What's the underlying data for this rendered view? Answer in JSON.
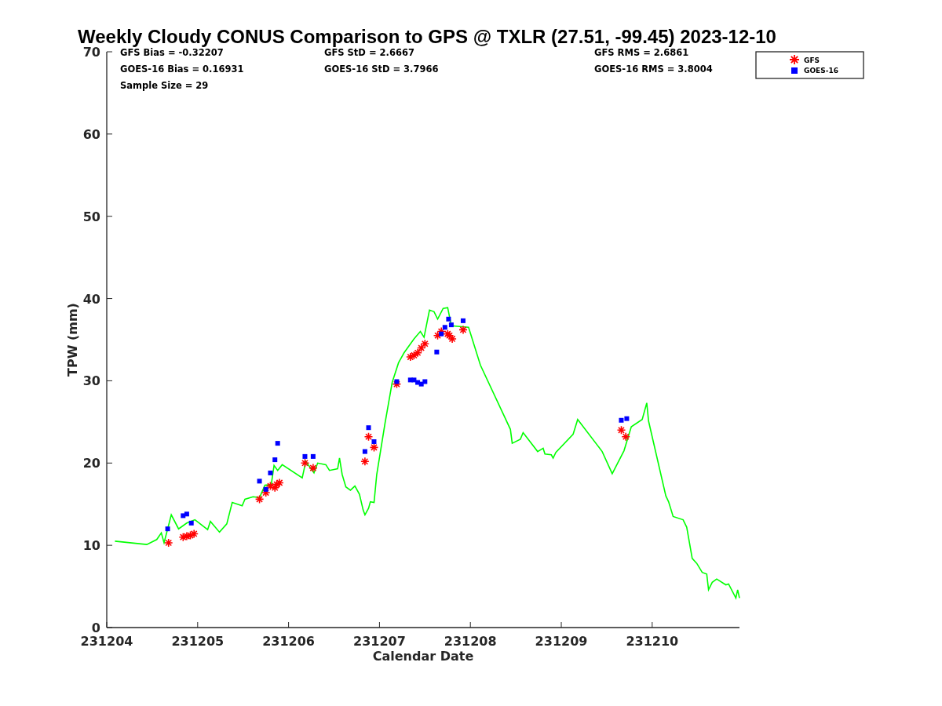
{
  "chart_data": {
    "type": "scatter",
    "title": "Weekly Cloudy CONUS Comparison to GPS @ TXLR (27.51, -99.45) 2023-12-10",
    "xlabel": "Calendar Date",
    "ylabel": "TPW (mm)",
    "legend": "top-right",
    "xlim": [
      231204,
      231210.96
    ],
    "ylim": [
      0,
      70
    ],
    "xticks": [
      231204,
      231205,
      231206,
      231207,
      231208,
      231209,
      231210
    ],
    "yticks": [
      0,
      10,
      20,
      30,
      40,
      50,
      60,
      70
    ],
    "annotations": [
      {
        "text": "GFS Bias = -0.32207"
      },
      {
        "text": "GFS StD = 2.6667"
      },
      {
        "text": "GFS RMS = 2.6861"
      },
      {
        "text": "GOES-16 Bias = 0.16931"
      },
      {
        "text": "GOES-16 StD = 3.7966"
      },
      {
        "text": "GOES-16 RMS = 3.8004"
      },
      {
        "text": "Sample Size = 29"
      }
    ],
    "series": [
      {
        "type": "line",
        "color": "#00ff00",
        "x": [
          231204.09,
          231204.44,
          231204.55,
          231204.6,
          231204.63,
          231204.71,
          231204.79,
          231204.88,
          231204.97,
          231205.11,
          231205.14,
          231205.24,
          231205.32,
          231205.38,
          231205.49,
          231205.52,
          231205.61,
          231205.68,
          231205.74,
          231205.81,
          231205.84,
          231205.88,
          231205.93,
          231206.15,
          231206.19,
          231206.28,
          231206.32,
          231206.41,
          231206.45,
          231206.54,
          231206.56,
          231206.59,
          231206.63,
          231206.68,
          231206.73,
          231206.78,
          231206.82,
          231206.84,
          231206.88,
          231206.9,
          231206.94,
          231206.97,
          231207.06,
          231207.14,
          231207.21,
          231207.27,
          231207.38,
          231207.45,
          231207.49,
          231207.55,
          231207.6,
          231207.64,
          231207.7,
          231207.75,
          231207.79,
          231207.98,
          231208.11,
          231208.44,
          231208.46,
          231208.55,
          231208.58,
          231208.74,
          231208.8,
          231208.82,
          231208.89,
          231208.91,
          231208.94,
          231209.13,
          231209.18,
          231209.45,
          231209.56,
          231209.69,
          231209.77,
          231209.89,
          231209.94,
          231209.96,
          231210.15,
          231210.18,
          231210.23,
          231210.34,
          231210.38,
          231210.44,
          231210.49,
          231210.55,
          231210.6,
          231210.62,
          231210.66,
          231210.71,
          231210.81,
          231210.84,
          231210.92,
          231210.94,
          231210.96
        ],
        "values": [
          10.5,
          10.1,
          10.7,
          11.5,
          10.3,
          13.7,
          12.0,
          12.7,
          13.1,
          11.9,
          12.9,
          11.6,
          12.6,
          15.2,
          14.8,
          15.6,
          15.9,
          15.8,
          17.3,
          17.4,
          19.7,
          19.1,
          19.8,
          18.2,
          20.2,
          18.8,
          20.0,
          19.8,
          19.1,
          19.3,
          20.6,
          18.6,
          17.1,
          16.7,
          17.2,
          16.2,
          14.3,
          13.7,
          14.5,
          15.3,
          15.2,
          18.6,
          24.8,
          29.8,
          32.2,
          33.4,
          35.1,
          36.0,
          35.3,
          38.6,
          38.4,
          37.5,
          38.8,
          38.9,
          36.7,
          36.5,
          31.9,
          24.1,
          22.4,
          22.9,
          23.7,
          21.4,
          21.8,
          21.1,
          21.0,
          20.6,
          21.3,
          23.5,
          25.3,
          21.4,
          18.7,
          21.5,
          24.4,
          25.3,
          27.3,
          25.1,
          16.0,
          15.3,
          13.5,
          13.1,
          12.2,
          8.4,
          7.8,
          6.7,
          6.5,
          4.6,
          5.5,
          5.9,
          5.2,
          5.3,
          3.6,
          4.6,
          3.6
        ]
      },
      {
        "type": "scatter",
        "marker": "cross",
        "name": "GFS",
        "color": "#ff0000",
        "x": [
          231204.68,
          231204.84,
          231204.88,
          231204.92,
          231204.96,
          231205.68,
          231205.75,
          231205.8,
          231205.85,
          231205.87,
          231205.9,
          231206.18,
          231206.27,
          231206.84,
          231206.88,
          231206.94,
          231207.19,
          231207.34,
          231207.38,
          231207.42,
          231207.46,
          231207.5,
          231207.64,
          231207.68,
          231207.75,
          231207.77,
          231207.8,
          231207.92,
          231209.66,
          231209.71
        ],
        "values": [
          10.3,
          11.0,
          11.1,
          11.2,
          11.4,
          15.6,
          16.4,
          17.2,
          17.0,
          17.4,
          17.6,
          20.0,
          19.4,
          20.2,
          23.2,
          21.9,
          29.6,
          32.9,
          33.1,
          33.4,
          34.0,
          34.5,
          35.5,
          36.0,
          35.7,
          35.5,
          35.1,
          36.2,
          24.0,
          23.2
        ]
      },
      {
        "type": "scatter",
        "marker": "square",
        "name": "GOES-16",
        "color": "#0000ff",
        "x": [
          231204.67,
          231204.84,
          231204.88,
          231204.93,
          231205.68,
          231205.75,
          231205.8,
          231205.85,
          231205.88,
          231206.18,
          231206.27,
          231206.84,
          231206.88,
          231206.94,
          231207.19,
          231207.34,
          231207.38,
          231207.42,
          231207.46,
          231207.5,
          231207.63,
          231207.68,
          231207.72,
          231207.76,
          231207.79,
          231207.92,
          231209.66,
          231209.72
        ],
        "values": [
          12.0,
          13.6,
          13.8,
          12.7,
          17.8,
          16.8,
          18.8,
          20.4,
          22.4,
          20.8,
          20.8,
          21.4,
          24.3,
          22.6,
          29.9,
          30.1,
          30.1,
          29.8,
          29.6,
          29.9,
          33.5,
          35.7,
          36.5,
          37.5,
          36.8,
          37.3,
          25.2,
          25.4
        ]
      }
    ]
  }
}
